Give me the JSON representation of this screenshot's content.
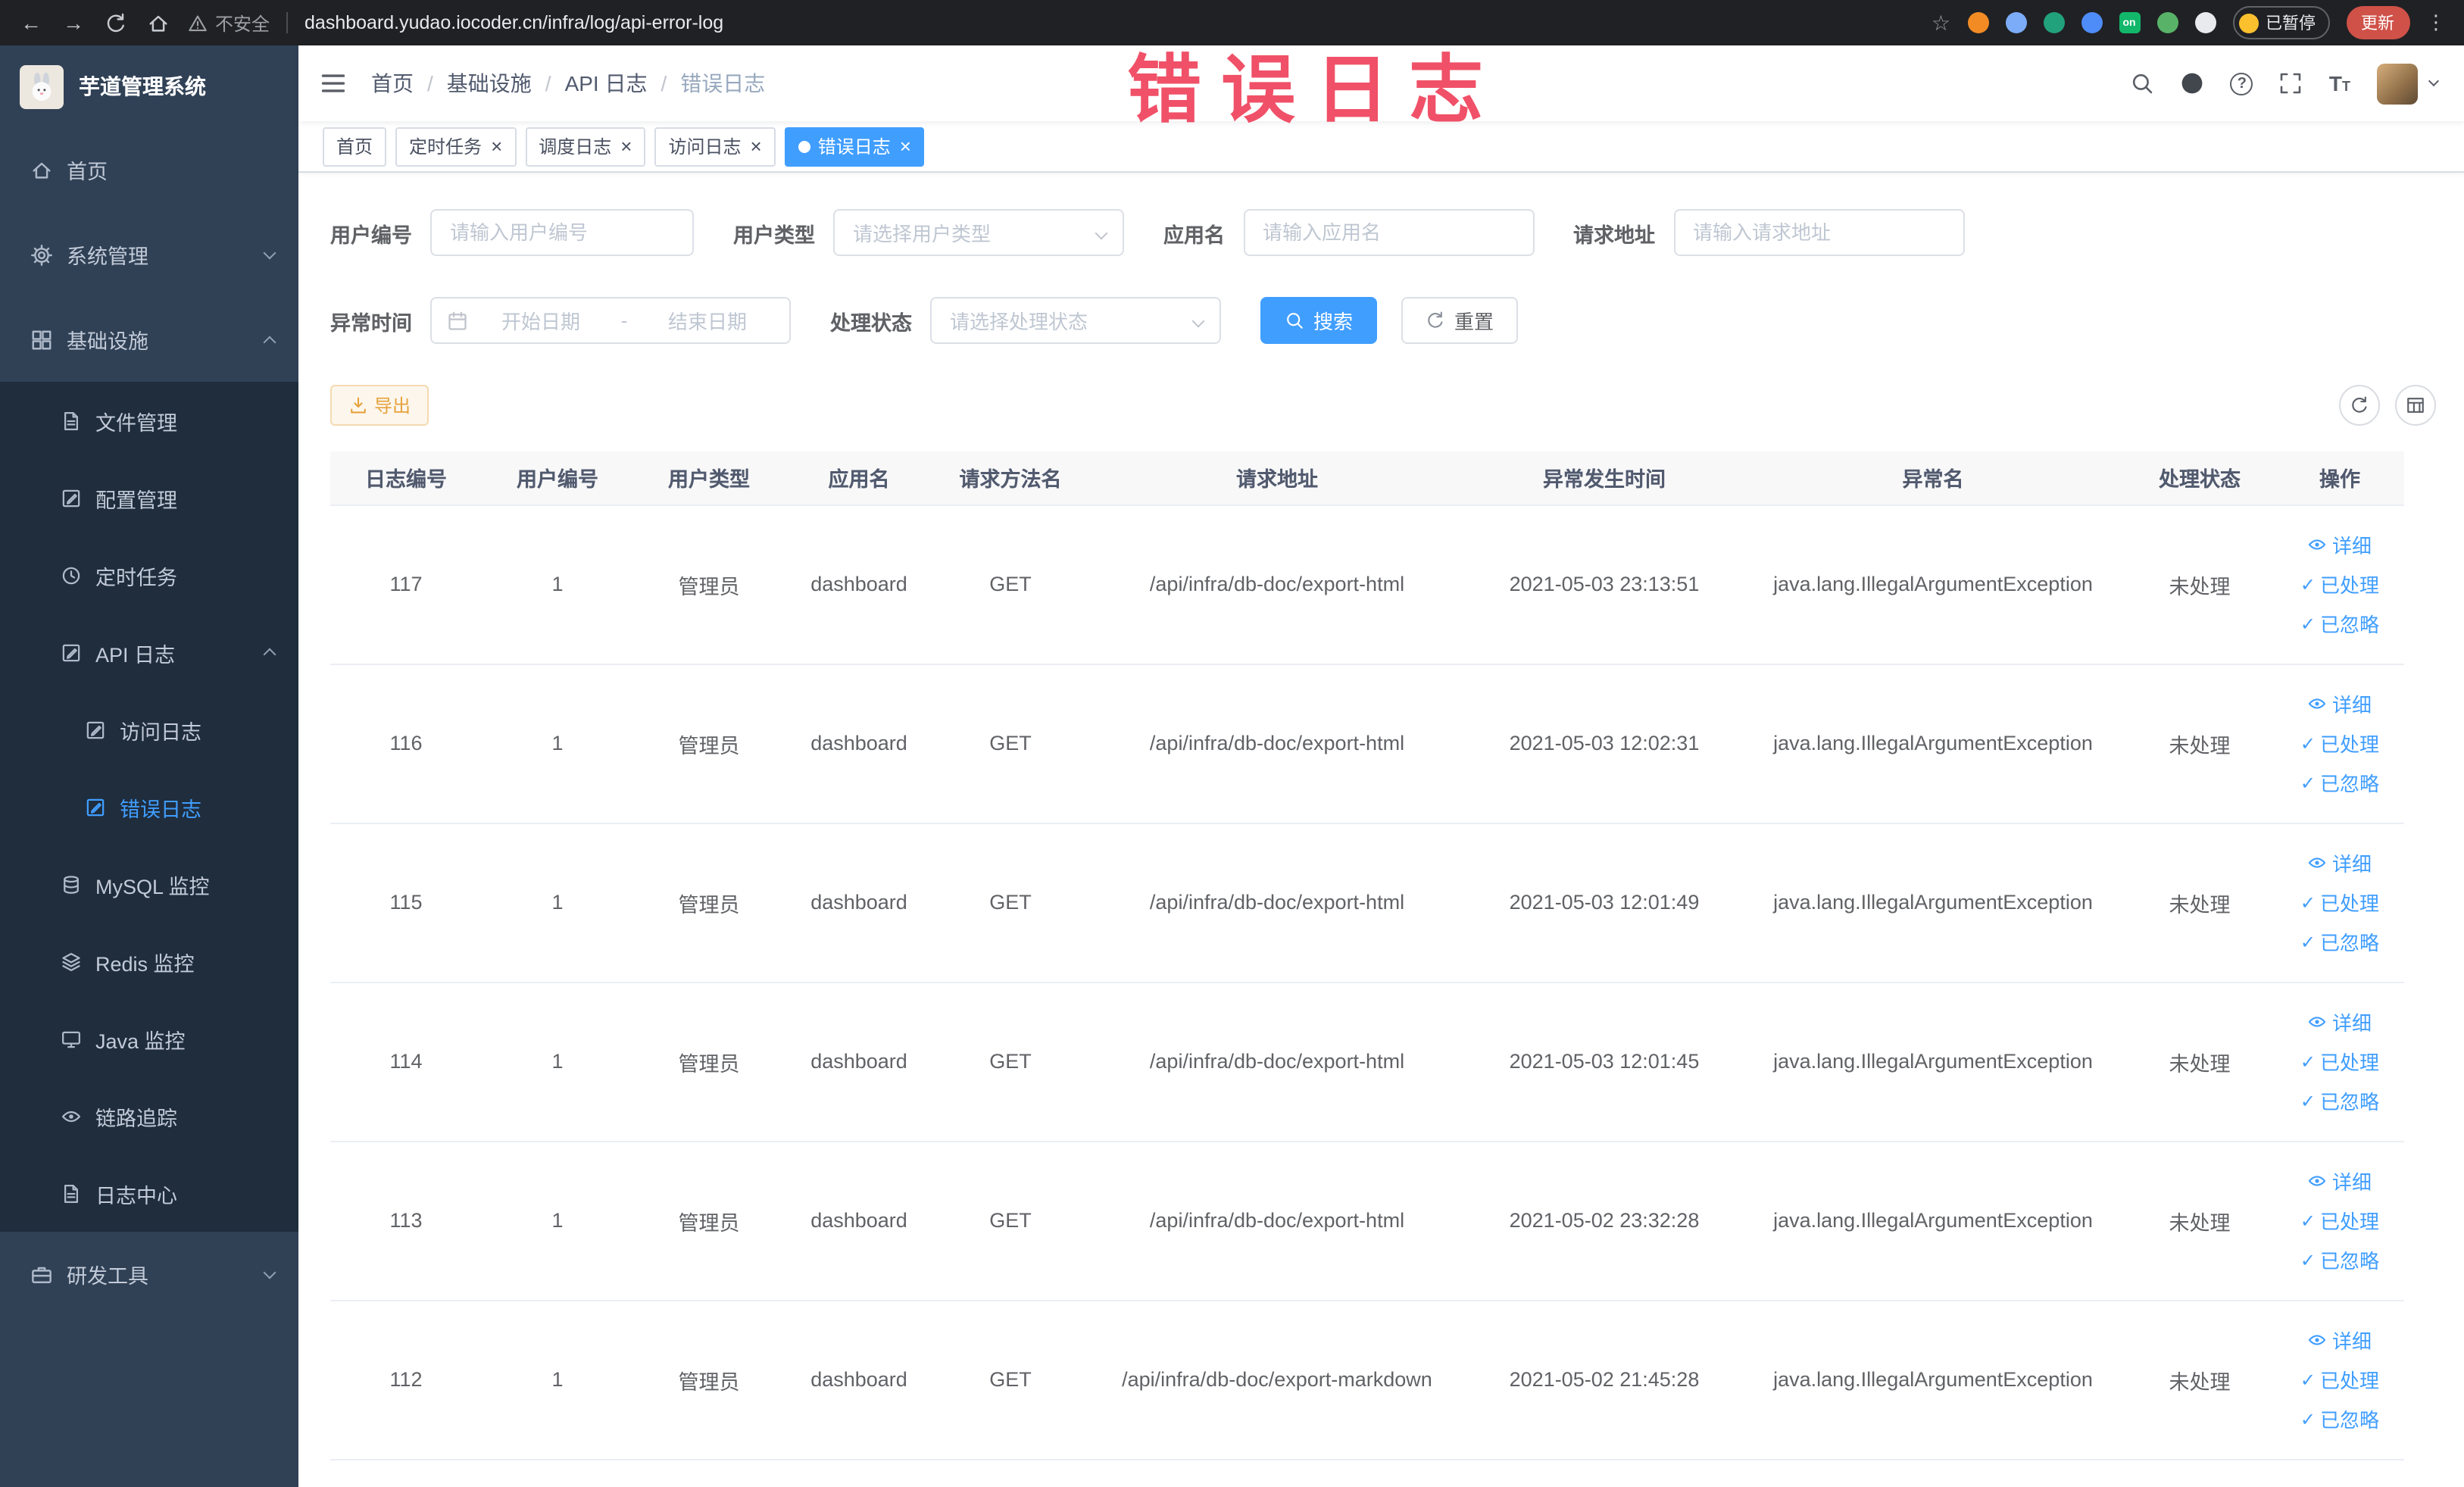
{
  "colors": {
    "accent": "#409EFF",
    "annotation_red": "#f0506a",
    "warning_button": "#e6a23c",
    "sidebar_bg": "#304156",
    "submenu_bg": "#1f2d3d",
    "update_button": "#cf5148"
  },
  "browser": {
    "security_label": "不安全",
    "url": "dashboard.yudao.iocoder.cn/infra/log/api-error-log",
    "extension_badge": "on",
    "paused_badge": "已暂停",
    "update_label": "更新"
  },
  "annotation": {
    "text": "错误日志"
  },
  "sidebar": {
    "logo_title": "芋道管理系统",
    "items": [
      {
        "label": "首页",
        "icon": "home-icon"
      },
      {
        "label": "系统管理",
        "icon": "gear-icon"
      },
      {
        "label": "基础设施",
        "icon": "grid-icon"
      },
      {
        "label": "文件管理",
        "icon": "document-icon"
      },
      {
        "label": "配置管理",
        "icon": "edit-icon"
      },
      {
        "label": "定时任务",
        "icon": "clock-icon"
      },
      {
        "label": "API 日志",
        "icon": "edit-icon"
      },
      {
        "label": "访问日志",
        "icon": "edit-icon"
      },
      {
        "label": "错误日志",
        "icon": "edit-icon"
      },
      {
        "label": "MySQL 监控",
        "icon": "database-icon"
      },
      {
        "label": "Redis 监控",
        "icon": "layers-icon"
      },
      {
        "label": "Java 监控",
        "icon": "monitor-icon"
      },
      {
        "label": "链路追踪",
        "icon": "eye-icon"
      },
      {
        "label": "日志中心",
        "icon": "document-icon"
      },
      {
        "label": "研发工具",
        "icon": "toolbox-icon"
      }
    ]
  },
  "breadcrumb": {
    "items": [
      "首页",
      "基础设施",
      "API 日志",
      "错误日志"
    ],
    "separator": "/"
  },
  "tabs": {
    "items": [
      {
        "name": "home",
        "label": "首页",
        "closable": false,
        "active": false
      },
      {
        "name": "scheduled-tasks",
        "label": "定时任务",
        "closable": true,
        "active": false
      },
      {
        "name": "schedule-log",
        "label": "调度日志",
        "closable": true,
        "active": false
      },
      {
        "name": "access-log",
        "label": "访问日志",
        "closable": true,
        "active": false
      },
      {
        "name": "error-log",
        "label": "错误日志",
        "closable": true,
        "active": true
      }
    ]
  },
  "filters": {
    "user_id": {
      "label": "用户编号",
      "placeholder": "请输入用户编号"
    },
    "user_type": {
      "label": "用户类型",
      "placeholder": "请选择用户类型"
    },
    "app_name": {
      "label": "应用名",
      "placeholder": "请输入应用名"
    },
    "request_url": {
      "label": "请求地址",
      "placeholder": "请输入请求地址"
    },
    "exception_time": {
      "label": "异常时间",
      "start_placeholder": "开始日期",
      "separator": "-",
      "end_placeholder": "结束日期"
    },
    "process_status": {
      "label": "处理状态",
      "placeholder": "请选择处理状态"
    },
    "search_label": "搜索",
    "reset_label": "重置"
  },
  "toolbar": {
    "export_label": "导出"
  },
  "table": {
    "columns": [
      "日志编号",
      "用户编号",
      "用户类型",
      "应用名",
      "请求方法名",
      "请求地址",
      "异常发生时间",
      "异常名",
      "处理状态",
      "操作"
    ],
    "action_labels": {
      "detail": "详细",
      "processed": "已处理",
      "ignored": "已忽略"
    },
    "rows": [
      {
        "id": "117",
        "user_id": "1",
        "user_type": "管理员",
        "app": "dashboard",
        "method": "GET",
        "url": "/api/infra/db-doc/export-html",
        "time": "2021-05-03 23:13:51",
        "exception": "java.lang.IllegalArgumentException",
        "status": "未处理"
      },
      {
        "id": "116",
        "user_id": "1",
        "user_type": "管理员",
        "app": "dashboard",
        "method": "GET",
        "url": "/api/infra/db-doc/export-html",
        "time": "2021-05-03 12:02:31",
        "exception": "java.lang.IllegalArgumentException",
        "status": "未处理"
      },
      {
        "id": "115",
        "user_id": "1",
        "user_type": "管理员",
        "app": "dashboard",
        "method": "GET",
        "url": "/api/infra/db-doc/export-html",
        "time": "2021-05-03 12:01:49",
        "exception": "java.lang.IllegalArgumentException",
        "status": "未处理"
      },
      {
        "id": "114",
        "user_id": "1",
        "user_type": "管理员",
        "app": "dashboard",
        "method": "GET",
        "url": "/api/infra/db-doc/export-html",
        "time": "2021-05-03 12:01:45",
        "exception": "java.lang.IllegalArgumentException",
        "status": "未处理"
      },
      {
        "id": "113",
        "user_id": "1",
        "user_type": "管理员",
        "app": "dashboard",
        "method": "GET",
        "url": "/api/infra/db-doc/export-html",
        "time": "2021-05-02 23:32:28",
        "exception": "java.lang.IllegalArgumentException",
        "status": "未处理"
      },
      {
        "id": "112",
        "user_id": "1",
        "user_type": "管理员",
        "app": "dashboard",
        "method": "GET",
        "url": "/api/infra/db-doc/export-markdown",
        "time": "2021-05-02 21:45:28",
        "exception": "java.lang.IllegalArgumentException",
        "status": "未处理"
      }
    ]
  }
}
